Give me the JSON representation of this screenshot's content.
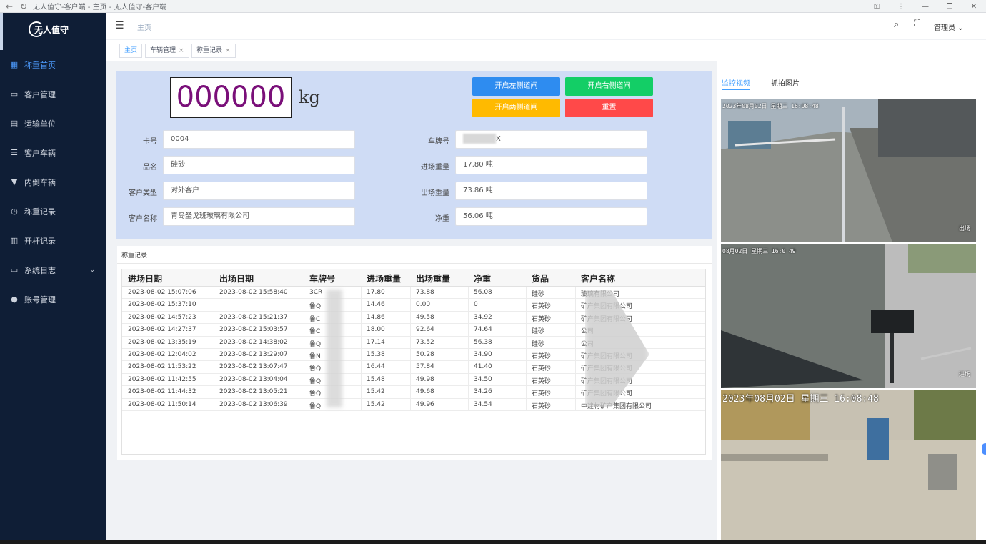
{
  "browser": {
    "title": "无人值守-客户端 - 主页 - 无人值守-客户端"
  },
  "sidebar": {
    "logo_text": "无人值守",
    "items": [
      {
        "label": "称重首页",
        "icon": "grid-icon"
      },
      {
        "label": "客户管理",
        "icon": "card-icon"
      },
      {
        "label": "运输单位",
        "icon": "building-icon"
      },
      {
        "label": "客户车辆",
        "icon": "list-icon"
      },
      {
        "label": "内倒车辆",
        "icon": "truck-icon"
      },
      {
        "label": "称重记录",
        "icon": "clock-icon"
      },
      {
        "label": "开杆记录",
        "icon": "doc-icon"
      },
      {
        "label": "系统日志",
        "icon": "monitor-icon"
      },
      {
        "label": "账号管理",
        "icon": "user-icon"
      }
    ]
  },
  "header": {
    "breadcrumb": "主页",
    "user": "管理员"
  },
  "tabs": [
    {
      "label": "主页"
    },
    {
      "label": "车辆管理"
    },
    {
      "label": "称重记录"
    }
  ],
  "weigh": {
    "display": "000000",
    "unit": "kg",
    "buttons": {
      "open_left": "开启左侧道闸",
      "open_right": "开启右侧道闸",
      "open_both": "开启两侧道闸",
      "reset": "重置"
    },
    "fields": {
      "card_no_label": "卡号",
      "card_no": "0004",
      "product_label": "品名",
      "product": "硅砂",
      "cust_type_label": "客户类型",
      "cust_type": "对外客户",
      "cust_name_label": "客户名称",
      "cust_name": "青岛圣戈班玻璃有限公司",
      "plate_label": "车牌号",
      "plate": "X",
      "in_weight_label": "进场重量",
      "in_weight": "17.80 吨",
      "out_weight_label": "出场重量",
      "out_weight": "73.86 吨",
      "net_label": "净重",
      "net": "56.06 吨"
    }
  },
  "records": {
    "title": "称重记录",
    "columns": [
      "进场日期",
      "出场日期",
      "车牌号",
      "进场重量",
      "出场重量",
      "净重",
      "货品",
      "客户名称"
    ],
    "rows": [
      [
        "2023-08-02 15:07:06",
        "2023-08-02 15:58:40",
        "3CR",
        "17.80",
        "73.88",
        "56.08",
        "硅砂",
        "玻璃有限公司"
      ],
      [
        "2023-08-02 15:37:10",
        "",
        "鲁Q",
        "14.46",
        "0.00",
        "0",
        "石英砂",
        "矿产集团有限公司"
      ],
      [
        "2023-08-02 14:57:23",
        "2023-08-02 15:21:37",
        "鲁C",
        "14.86",
        "49.58",
        "34.92",
        "石英砂",
        "矿产集团有限公司"
      ],
      [
        "2023-08-02 14:27:37",
        "2023-08-02 15:03:57",
        "鲁C",
        "18.00",
        "92.64",
        "74.64",
        "硅砂",
        "公司"
      ],
      [
        "2023-08-02 13:35:19",
        "2023-08-02 14:38:02",
        "鲁Q",
        "17.14",
        "73.52",
        "56.38",
        "硅砂",
        "公司"
      ],
      [
        "2023-08-02 12:04:02",
        "2023-08-02 13:29:07",
        "鲁N",
        "15.38",
        "50.28",
        "34.90",
        "石英砂",
        "矿产集团有限公司"
      ],
      [
        "2023-08-02 11:53:22",
        "2023-08-02 13:07:47",
        "鲁Q",
        "16.44",
        "57.84",
        "41.40",
        "石英砂",
        "矿产集团有限公司"
      ],
      [
        "2023-08-02 11:42:55",
        "2023-08-02 13:04:04",
        "鲁Q",
        "15.48",
        "49.98",
        "34.50",
        "石英砂",
        "矿产集团有限公司"
      ],
      [
        "2023-08-02 11:44:32",
        "2023-08-02 13:05:21",
        "鲁Q",
        "15.42",
        "49.68",
        "34.26",
        "石英砂",
        "矿产集团有限公司"
      ],
      [
        "2023-08-02 11:50:14",
        "2023-08-02 13:06:39",
        "鲁Q",
        "15.42",
        "49.96",
        "34.54",
        "石英砂",
        "中建材矿产集团有限公司"
      ]
    ]
  },
  "video": {
    "tabs": [
      "监控视频",
      "抓拍图片"
    ],
    "cams": [
      {
        "stamp": "2023年08月02日  星期三  16:08:48",
        "tag": "出场"
      },
      {
        "stamp": "08月02日  星期三  16:0  49",
        "tag": "进场"
      },
      {
        "stamp": "2023年08月02日  星期三  16:08:48",
        "tag": ""
      }
    ]
  }
}
